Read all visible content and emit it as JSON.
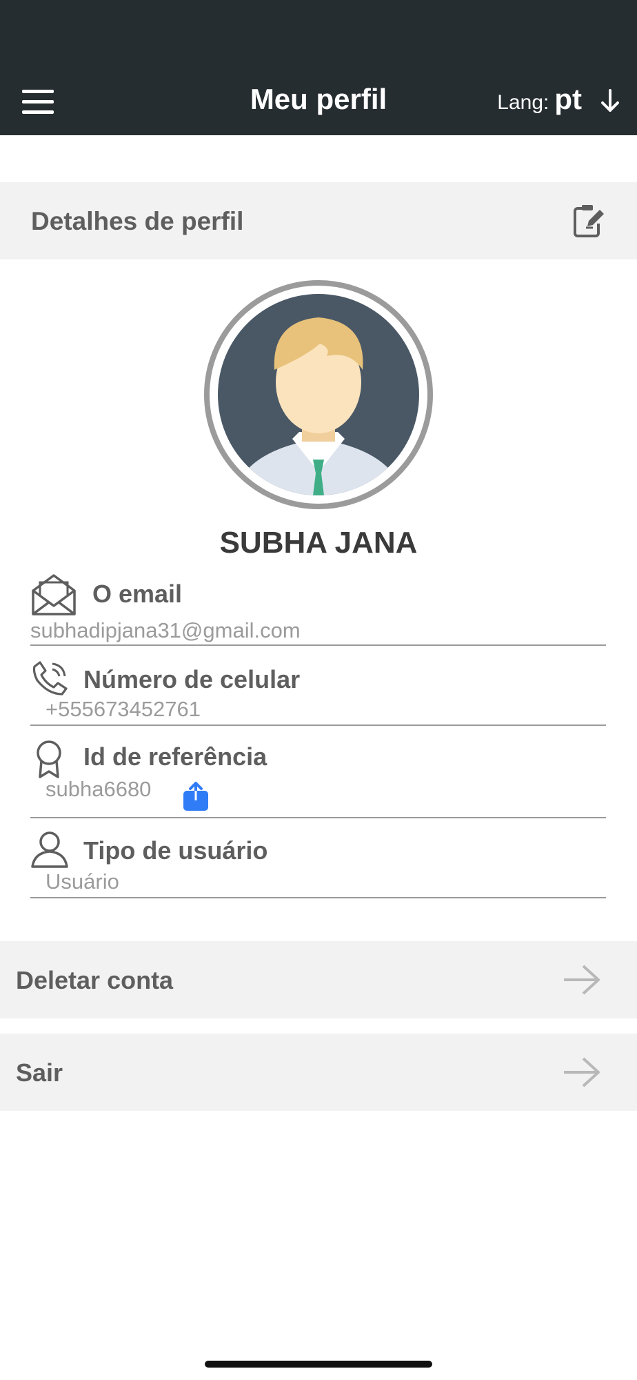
{
  "header": {
    "title": "Meu perfil",
    "lang_label": "Lang:",
    "lang_value": "pt"
  },
  "profile_section": {
    "title": "Detalhes de perfil"
  },
  "user": {
    "name": "SUBHA JANA"
  },
  "fields": {
    "email": {
      "label": "O email",
      "value": "subhadipjana31@gmail.com"
    },
    "phone": {
      "label": "Número de celular",
      "value": "+555673452761"
    },
    "referral": {
      "label": "Id de referência",
      "value": "subha6680"
    },
    "user_type": {
      "label": "Tipo de usuário",
      "value": "Usuário"
    }
  },
  "actions": {
    "delete_account": "Deletar conta",
    "logout": "Sair"
  },
  "colors": {
    "header_bg": "#262d31",
    "section_bg": "#f2f2f2",
    "label_text": "#5e5e5e",
    "value_text": "#9b9b9b",
    "share_accent": "#2f7cf6"
  },
  "icons": {
    "menu": "hamburger-icon",
    "lang": "arrow-down-icon",
    "edit": "edit-document-icon",
    "email": "open-envelope-icon",
    "phone": "phone-call-icon",
    "referral": "award-ribbon-icon",
    "share": "share-upload-icon",
    "user_type": "user-outline-icon",
    "row_arrow": "arrow-right-icon"
  }
}
